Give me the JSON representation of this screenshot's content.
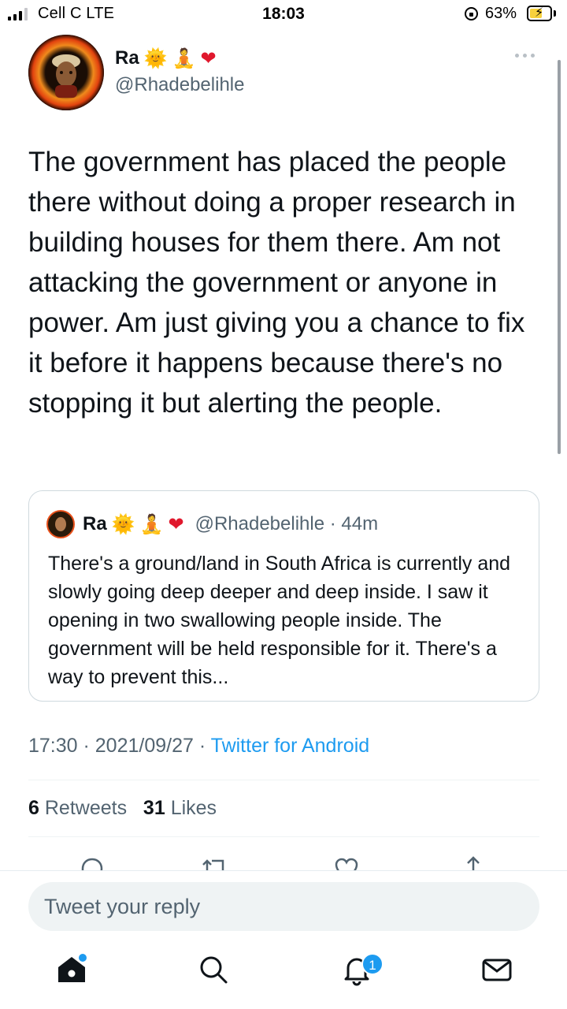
{
  "status_bar": {
    "carrier": "Cell C  LTE",
    "time": "18:03",
    "battery_percent": "63%",
    "battery_level": 0.63,
    "battery_charging": true
  },
  "tweet": {
    "author": {
      "name": "Ra",
      "emojis": [
        "🌞",
        "🧘",
        "❤"
      ],
      "handle": "@Rhadebelihle"
    },
    "text": "The government has placed the people there without doing a proper research in building houses for them there. Am not attacking the government or anyone in power. Am just giving you a chance to fix it before it happens because there's no stopping it but alerting the people.",
    "quoted": {
      "name": "Ra",
      "emojis": [
        "🌞",
        "🧘",
        "❤"
      ],
      "handle_time": "@Rhadebelihle · 44m",
      "text": "There's a ground/land in South Africa is currently and slowly going deep deeper and deep inside. I saw it opening in two swallowing people inside. The government will be held responsible for it. There's a way to prevent this..."
    },
    "meta": {
      "time": "17:30",
      "sep1": " · ",
      "date": "2021/09/27",
      "sep2": " · ",
      "source": "Twitter for Android"
    },
    "stats": {
      "retweets_count": "6",
      "retweets_label": "Retweets",
      "likes_count": "31",
      "likes_label": "Likes"
    }
  },
  "reply": {
    "placeholder": "Tweet your reply"
  },
  "nav": {
    "notifications_badge": "1"
  },
  "colors": {
    "accent": "#1d9bf0",
    "text": "#0f1419",
    "secondary": "#536471"
  }
}
